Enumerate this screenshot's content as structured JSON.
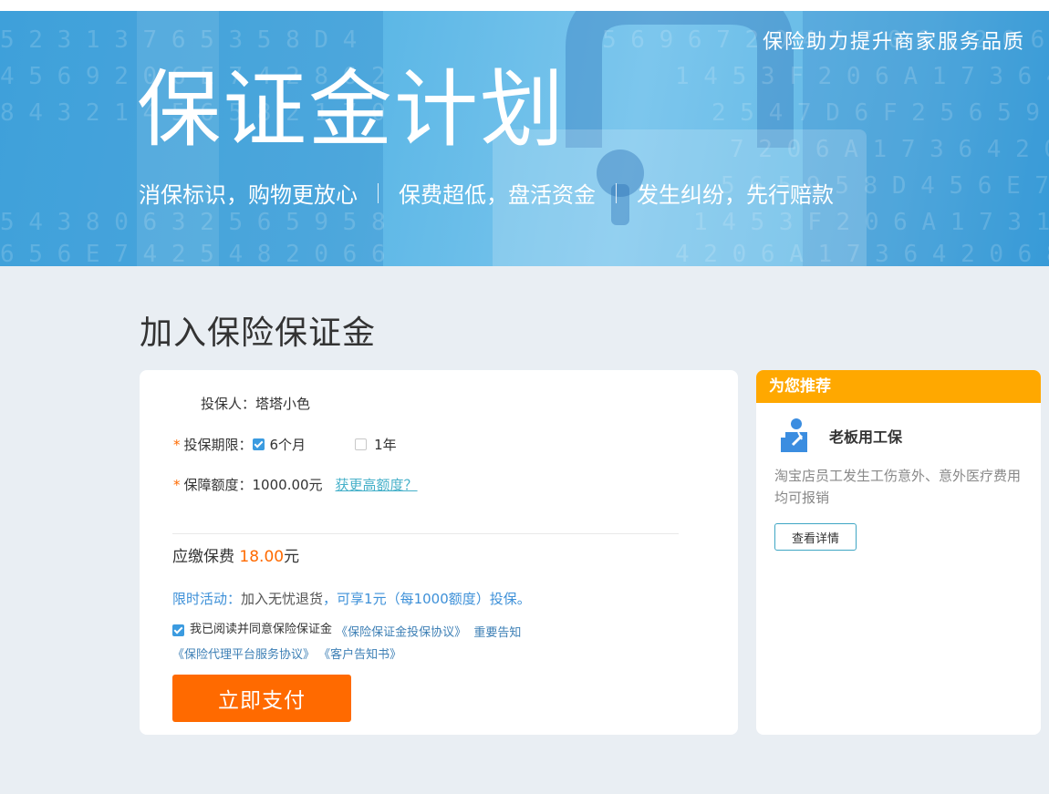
{
  "banner": {
    "slogan": "保险助力提升商家服务品质",
    "title": "保证金计划",
    "taglines": [
      "消保标识，购物更放心",
      "保费超低，盘活资金",
      "发生纠纷，先行赔款"
    ]
  },
  "section_title": "加入保险保证金",
  "form": {
    "insured_label": "投保人：",
    "insured_value": "塔塔小色",
    "required_mark": "*",
    "period_label": "投保期限：",
    "period_options": [
      {
        "label": "6个月",
        "checked": true
      },
      {
        "label": "1年",
        "checked": false
      }
    ],
    "coverage_label": "保障额度：",
    "coverage_value": "1000.00元",
    "coverage_link": "获更高额度？",
    "fee_label": "应缴保费",
    "fee_amount": "18.00",
    "fee_unit": "元",
    "promo_prefix": "限时活动：",
    "promo_mid": "加入无忧退货",
    "promo_suffix": "，可享1元（每1000额度）投保。",
    "agree_text": "我已阅读并同意保险保证金",
    "agree_links": [
      "《保险保证金投保协议》",
      "重要告知",
      "《保险代理平台服务协议》",
      "《客户告知书》"
    ],
    "pay_button": "立即支付"
  },
  "sidebar": {
    "header": "为您推荐",
    "product_name": "老板用工保",
    "description": "淘宝店员工发生工伤意外、意外医疗费用均可报销",
    "detail_button": "查看详情"
  },
  "colors": {
    "accent_orange": "#ff6a00",
    "sidebar_header": "#ffa800",
    "link_blue": "#3d90d8",
    "banner_blue": "#5cb7e6"
  }
}
